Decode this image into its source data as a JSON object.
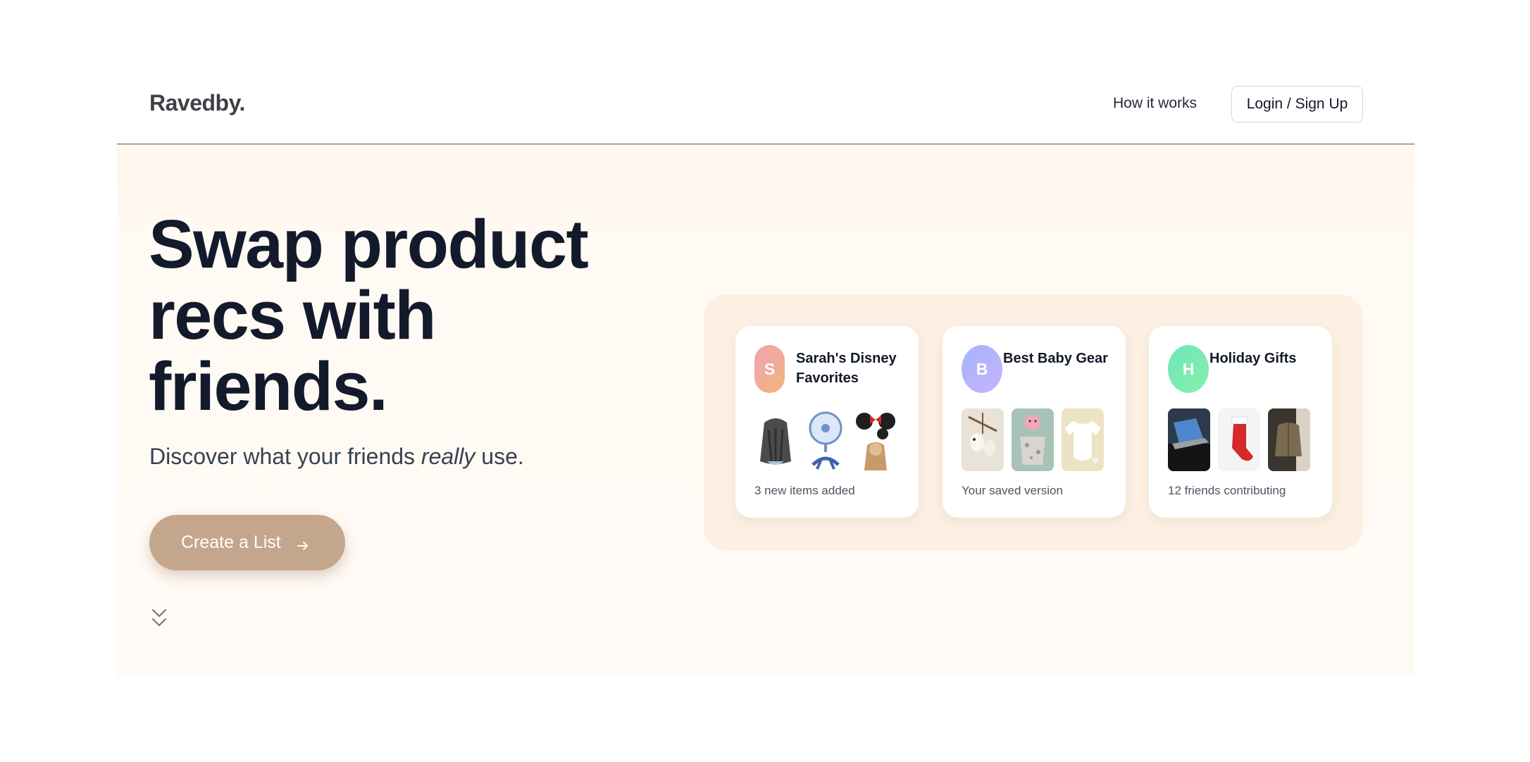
{
  "brand": {
    "logo": "Ravedby."
  },
  "nav": {
    "how_it_works": "How it works",
    "login": "Login / Sign Up"
  },
  "hero": {
    "headline_line1": "Swap product",
    "headline_line2": "recs with",
    "headline_line3": "friends.",
    "sub_before": "Discover what your friends ",
    "sub_emphasis": "really",
    "sub_after": " use.",
    "cta_label": "Create a List"
  },
  "cards": [
    {
      "initial": "S",
      "title": "Sarah's Disney Favorites",
      "caption": "3 new items added",
      "avatar_colors": [
        "#f3a3b5",
        "#f2b47a"
      ]
    },
    {
      "initial": "B",
      "title": "Best Baby Gear",
      "caption": "Your saved version",
      "avatar_colors": [
        "#a5b4fc",
        "#c4b5fd"
      ]
    },
    {
      "initial": "H",
      "title": "Holiday Gifts",
      "caption": "12 friends contributing",
      "avatar_colors": [
        "#6ee7b7",
        "#86efac"
      ]
    }
  ],
  "icons": {
    "cta_arrow": "arrow-right-icon",
    "scroll_hint": "double-chevron-down-icon"
  },
  "colors": {
    "cta": "#c4a68d",
    "hero_bg": "#fffaf4",
    "panel_bg": "#fdf0e3",
    "headline": "#131a2b"
  }
}
